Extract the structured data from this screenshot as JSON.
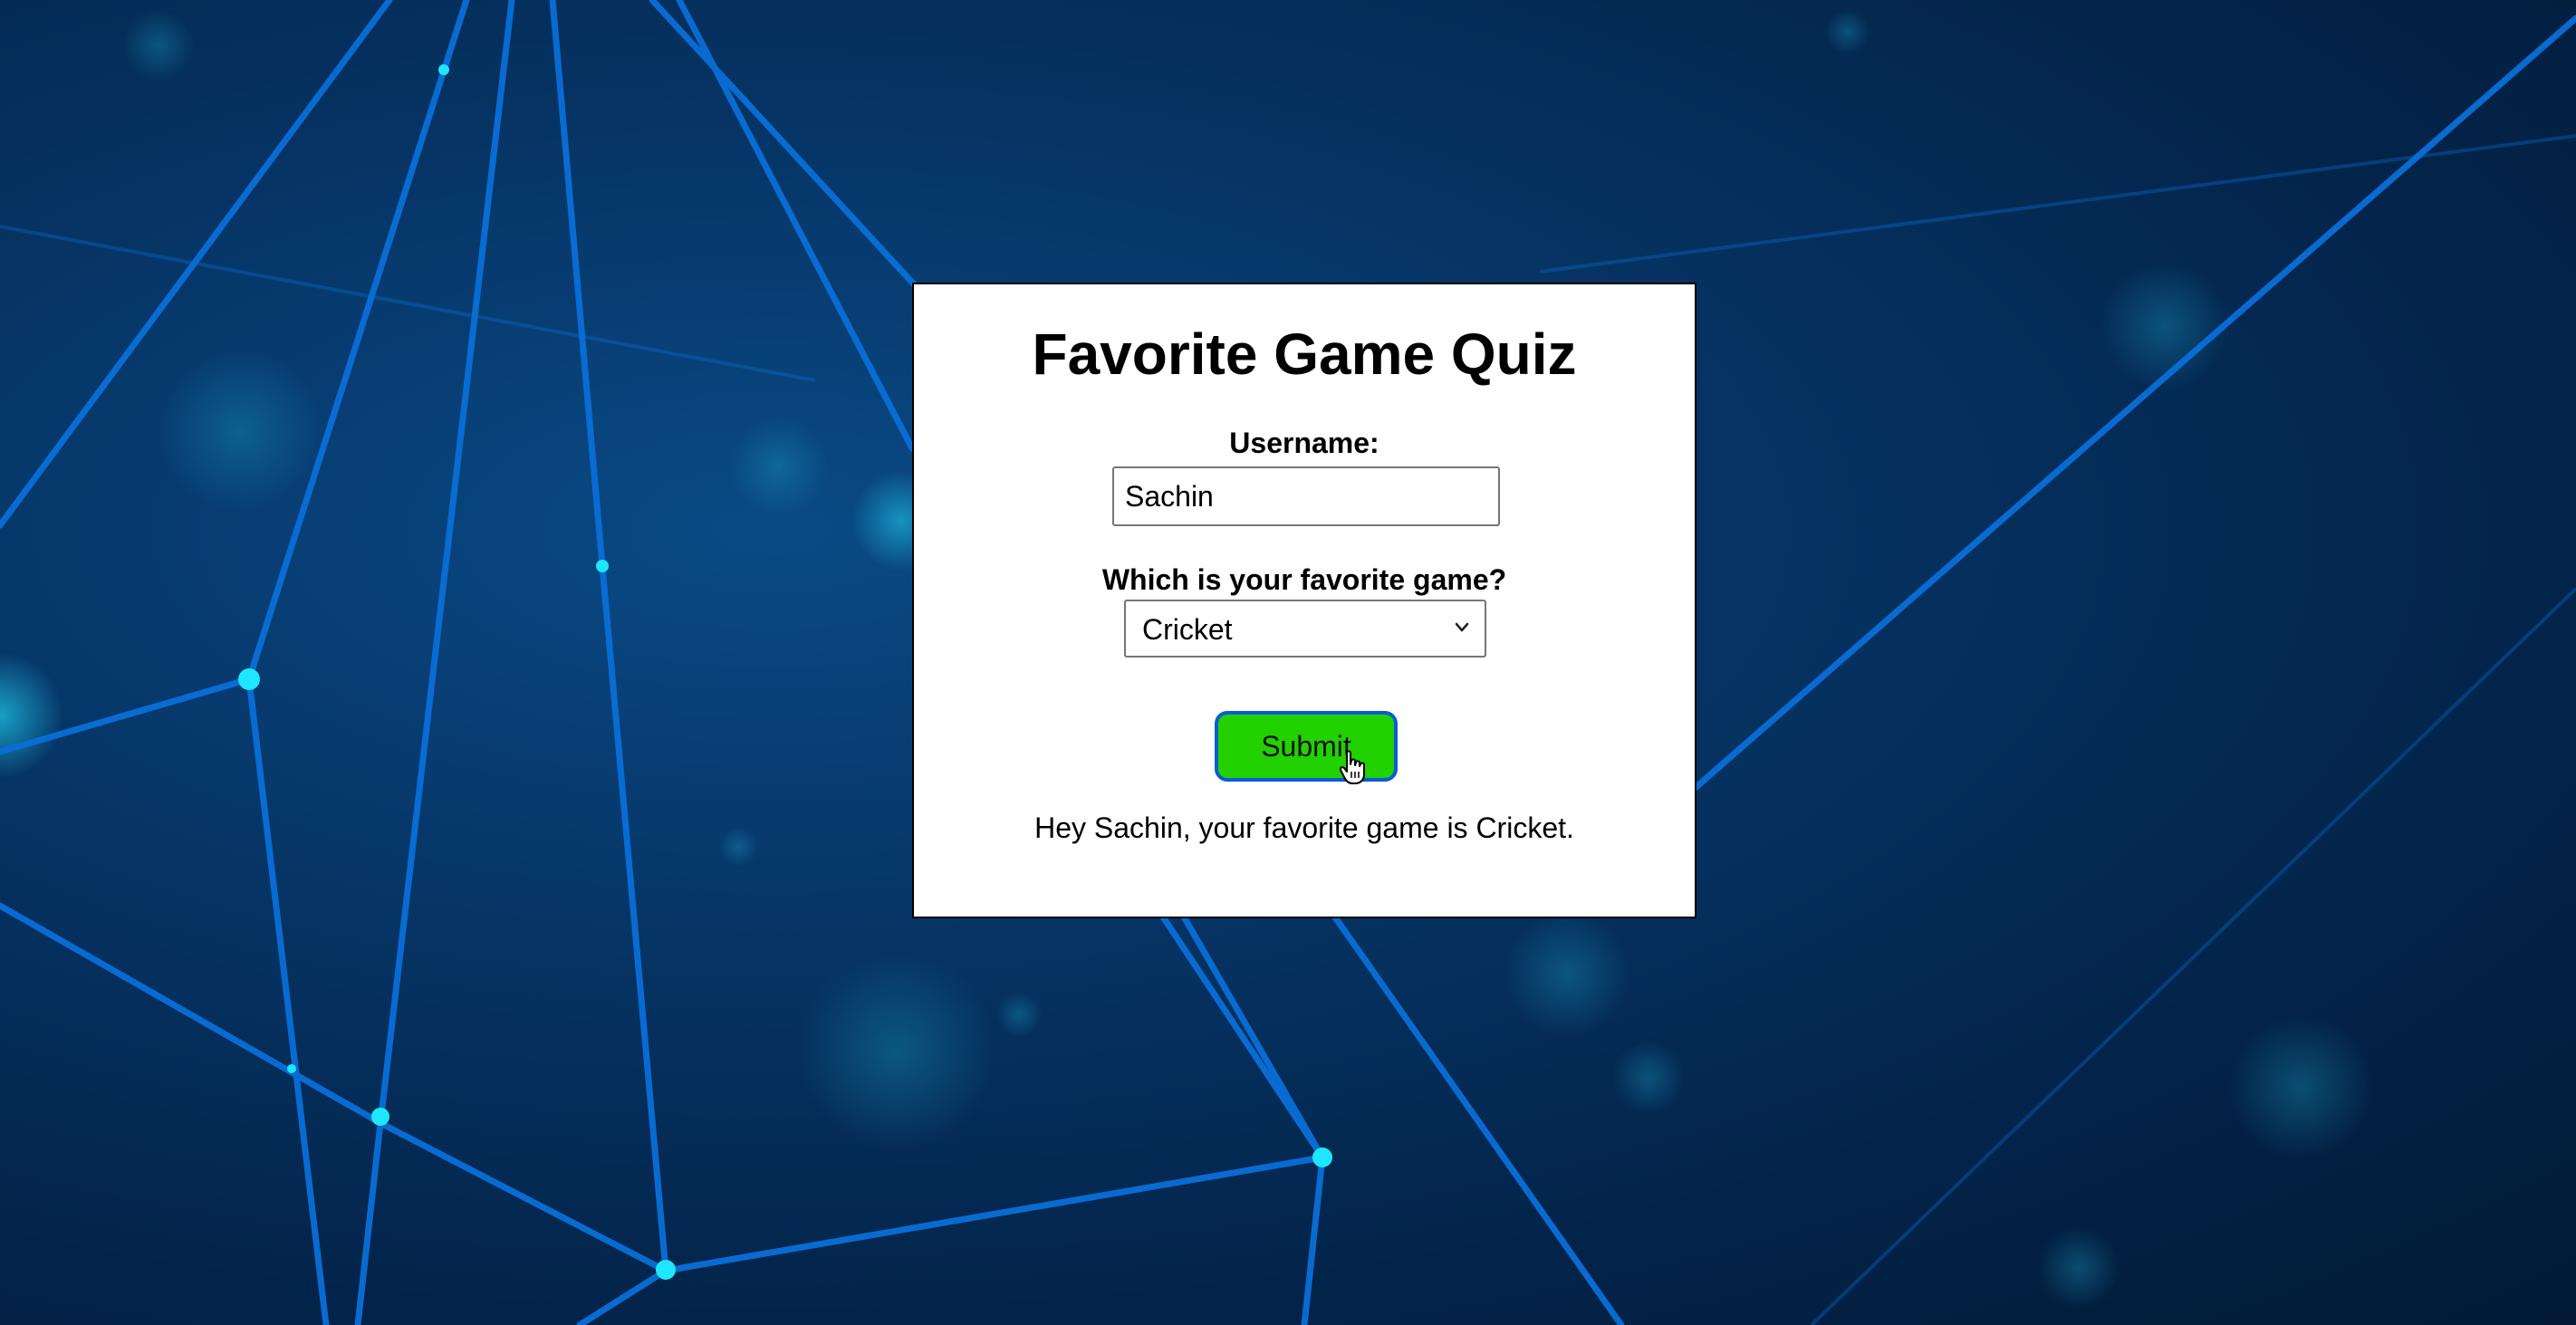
{
  "quiz": {
    "title": "Favorite Game Quiz",
    "username_label": "Username:",
    "username_value": "Sachin",
    "game_label": "Which is your favorite game?",
    "game_selected": "Cricket",
    "submit_label": "Submit",
    "result_text": "Hey Sachin, your favorite game is Cricket."
  },
  "colors": {
    "submit_bg": "#22d100",
    "submit_border": "#0a5bd6",
    "card_bg": "#ffffff"
  },
  "icons": {
    "select": "chevron-down-icon",
    "pointer": "hand-cursor-icon"
  }
}
